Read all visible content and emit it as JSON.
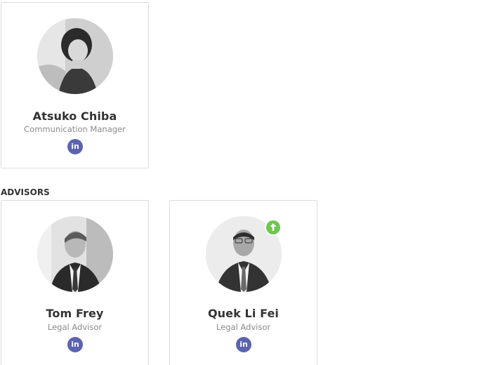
{
  "team": [
    {
      "name": "Atsuko Chiba",
      "role": "Communication Manager",
      "social": {
        "icon": "linkedin-icon",
        "label": "in"
      }
    }
  ],
  "advisors_section": {
    "title": "ADVISORS",
    "members": [
      {
        "name": "Tom Frey",
        "role": "Legal Advisor",
        "social": {
          "icon": "linkedin-icon",
          "label": "in"
        }
      },
      {
        "name": "Quek Li Fei",
        "role": "Legal Advisor",
        "social": {
          "icon": "linkedin-icon",
          "label": "in"
        },
        "badge": {
          "icon": "arrow-up-icon",
          "color": "#6cc84d"
        }
      }
    ]
  },
  "colors": {
    "linkedin": "#5b63b0",
    "card_border": "#dcdcdc",
    "name_text": "#333333",
    "role_text": "#8a8a8a",
    "badge_green": "#6cc84d"
  }
}
